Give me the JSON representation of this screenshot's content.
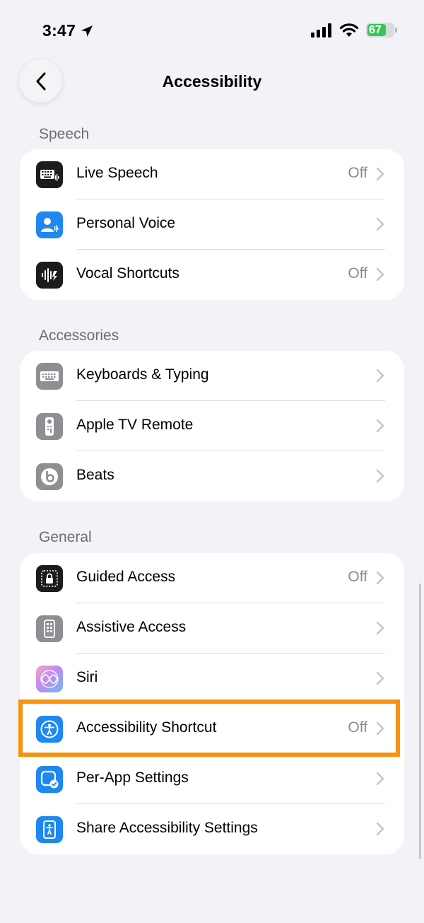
{
  "status_bar": {
    "time": "3:47",
    "battery": "67"
  },
  "nav": {
    "title": "Accessibility"
  },
  "sections": [
    {
      "header": "Speech",
      "items": [
        {
          "label": "Live Speech",
          "value": "Off",
          "icon": "keyboard-waveform-icon",
          "icon_bg": "#1c1c1e"
        },
        {
          "label": "Personal Voice",
          "value": "",
          "icon": "person-waveform-icon",
          "icon_bg": "#1e88f0"
        },
        {
          "label": "Vocal Shortcuts",
          "value": "Off",
          "icon": "waveform-icon",
          "icon_bg": "#1c1c1e"
        }
      ]
    },
    {
      "header": "Accessories",
      "items": [
        {
          "label": "Keyboards & Typing",
          "value": "",
          "icon": "keyboard-icon",
          "icon_bg": "#8e8e93"
        },
        {
          "label": "Apple TV Remote",
          "value": "",
          "icon": "remote-icon",
          "icon_bg": "#8e8e93"
        },
        {
          "label": "Beats",
          "value": "",
          "icon": "beats-icon",
          "icon_bg": "#8e8e93"
        }
      ]
    },
    {
      "header": "General",
      "items": [
        {
          "label": "Guided Access",
          "value": "Off",
          "icon": "lock-icon",
          "icon_bg": "#1c1c1e"
        },
        {
          "label": "Assistive Access",
          "value": "",
          "icon": "assistive-grid-icon",
          "icon_bg": "#8e8e93"
        },
        {
          "label": "Siri",
          "value": "",
          "icon": "siri-icon",
          "icon_bg": "#b58ae8"
        },
        {
          "label": "Accessibility Shortcut",
          "value": "Off",
          "icon": "accessibility-icon",
          "icon_bg": "#1e88f0"
        },
        {
          "label": "Per-App Settings",
          "value": "",
          "icon": "app-check-icon",
          "icon_bg": "#1e88f0"
        },
        {
          "label": "Share Accessibility Settings",
          "value": "",
          "icon": "share-accessibility-icon",
          "icon_bg": "#1e88f0"
        }
      ]
    }
  ],
  "highlight": {
    "target": "Accessibility Shortcut",
    "color": "#f7930e"
  }
}
